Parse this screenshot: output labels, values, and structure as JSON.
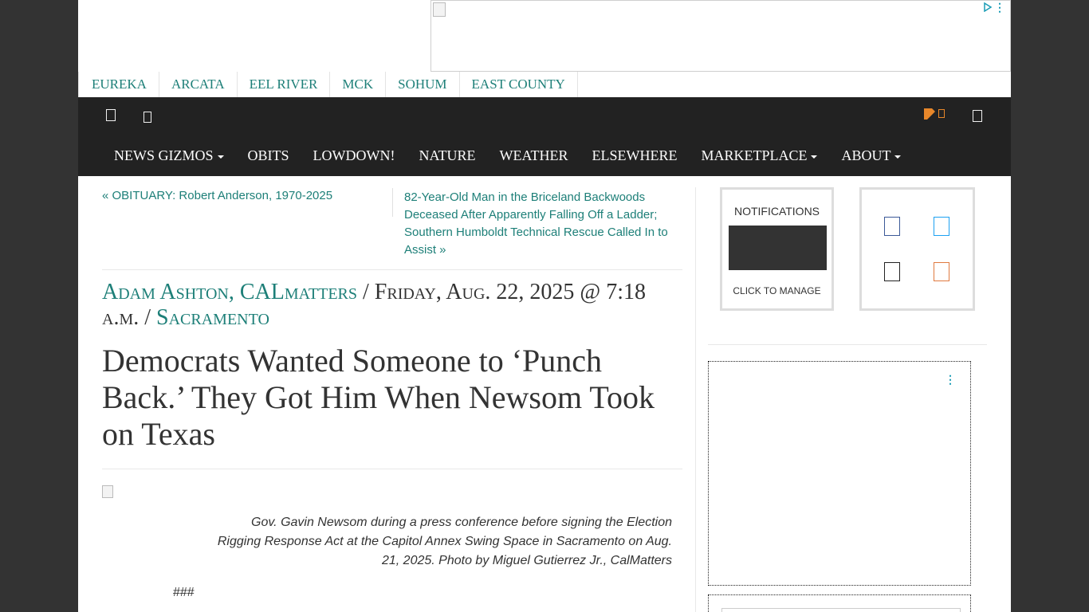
{
  "regions": [
    "EUREKA",
    "ARCATA",
    "EEL RIVER",
    "MCK",
    "SOHUM",
    "EAST COUNTY"
  ],
  "header_icons": [
    "facebook-icon",
    "twitter-icon",
    "rss-icon",
    "search-icon"
  ],
  "nav": [
    {
      "label": "NEWS GIZMOS",
      "dropdown": true
    },
    {
      "label": "OBITS",
      "dropdown": false
    },
    {
      "label": "LOWDOWN!",
      "dropdown": false
    },
    {
      "label": "NATURE",
      "dropdown": false
    },
    {
      "label": "WEATHER",
      "dropdown": false
    },
    {
      "label": "ELSEWHERE",
      "dropdown": false
    },
    {
      "label": "MARKETPLACE",
      "dropdown": true
    },
    {
      "label": "ABOUT",
      "dropdown": true
    }
  ],
  "article": {
    "prev_link": "« OBITUARY: Robert Anderson, 1970-2025",
    "next_link": "82-Year-Old Man in the Briceland Backwoods Deceased After Apparently Falling Off a Ladder; Southern Humboldt Technical Rescue Called In to Assist »",
    "author": "Adam Ashton, CALmatters",
    "date": "Friday, Aug. 22, 2025 @ 7:18 a.m.",
    "location": "Sacramento",
    "separator": "/",
    "headline": "Democrats Wanted Someone to ‘Punch Back.’ They Got Him When Newsom Took on Texas",
    "caption": "Gov. Gavin Newsom during a press conference before signing the Election Rigging Response Act at the Capitol Annex Swing Space in Sacramento on Aug. 21, 2025. Photo by Miguel Gutierrez Jr., CalMatters",
    "section_mark": "###"
  },
  "sidebar": {
    "notifications_title": "NOTIFICATIONS",
    "notifications_manage": "CLICK TO MANAGE",
    "social_icons": [
      "facebook-icon",
      "twitter-icon",
      "instagram-icon",
      "rss-icon"
    ]
  },
  "colors": {
    "accent": "#1d7f78",
    "header_bg": "#222222",
    "page_bg": "#333333",
    "rss": "#e8872a"
  }
}
